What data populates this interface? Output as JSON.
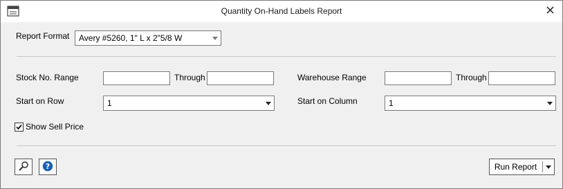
{
  "window": {
    "title": "Quantity On-Hand Labels Report"
  },
  "report_format": {
    "label": "Report Format",
    "value": "Avery #5260, 1\" L x 2\"5/8 W"
  },
  "stock_range": {
    "label": "Stock No. Range",
    "from": "",
    "through_label": "Through",
    "to": ""
  },
  "warehouse_range": {
    "label": "Warehouse Range",
    "from": "",
    "through_label": "Through",
    "to": ""
  },
  "start_row": {
    "label": "Start on Row",
    "value": "1"
  },
  "start_column": {
    "label": "Start on Column",
    "value": "1"
  },
  "show_sell_price": {
    "label": "Show Sell Price",
    "checked": true
  },
  "footer": {
    "run_report_label": "Run Report"
  },
  "icons": {
    "app": "report-window-icon",
    "close": "close-icon",
    "search": "magnifier-icon",
    "help": "help-icon"
  },
  "colors": {
    "help_blue": "#1a5fb4",
    "border": "#7a7a7a"
  }
}
